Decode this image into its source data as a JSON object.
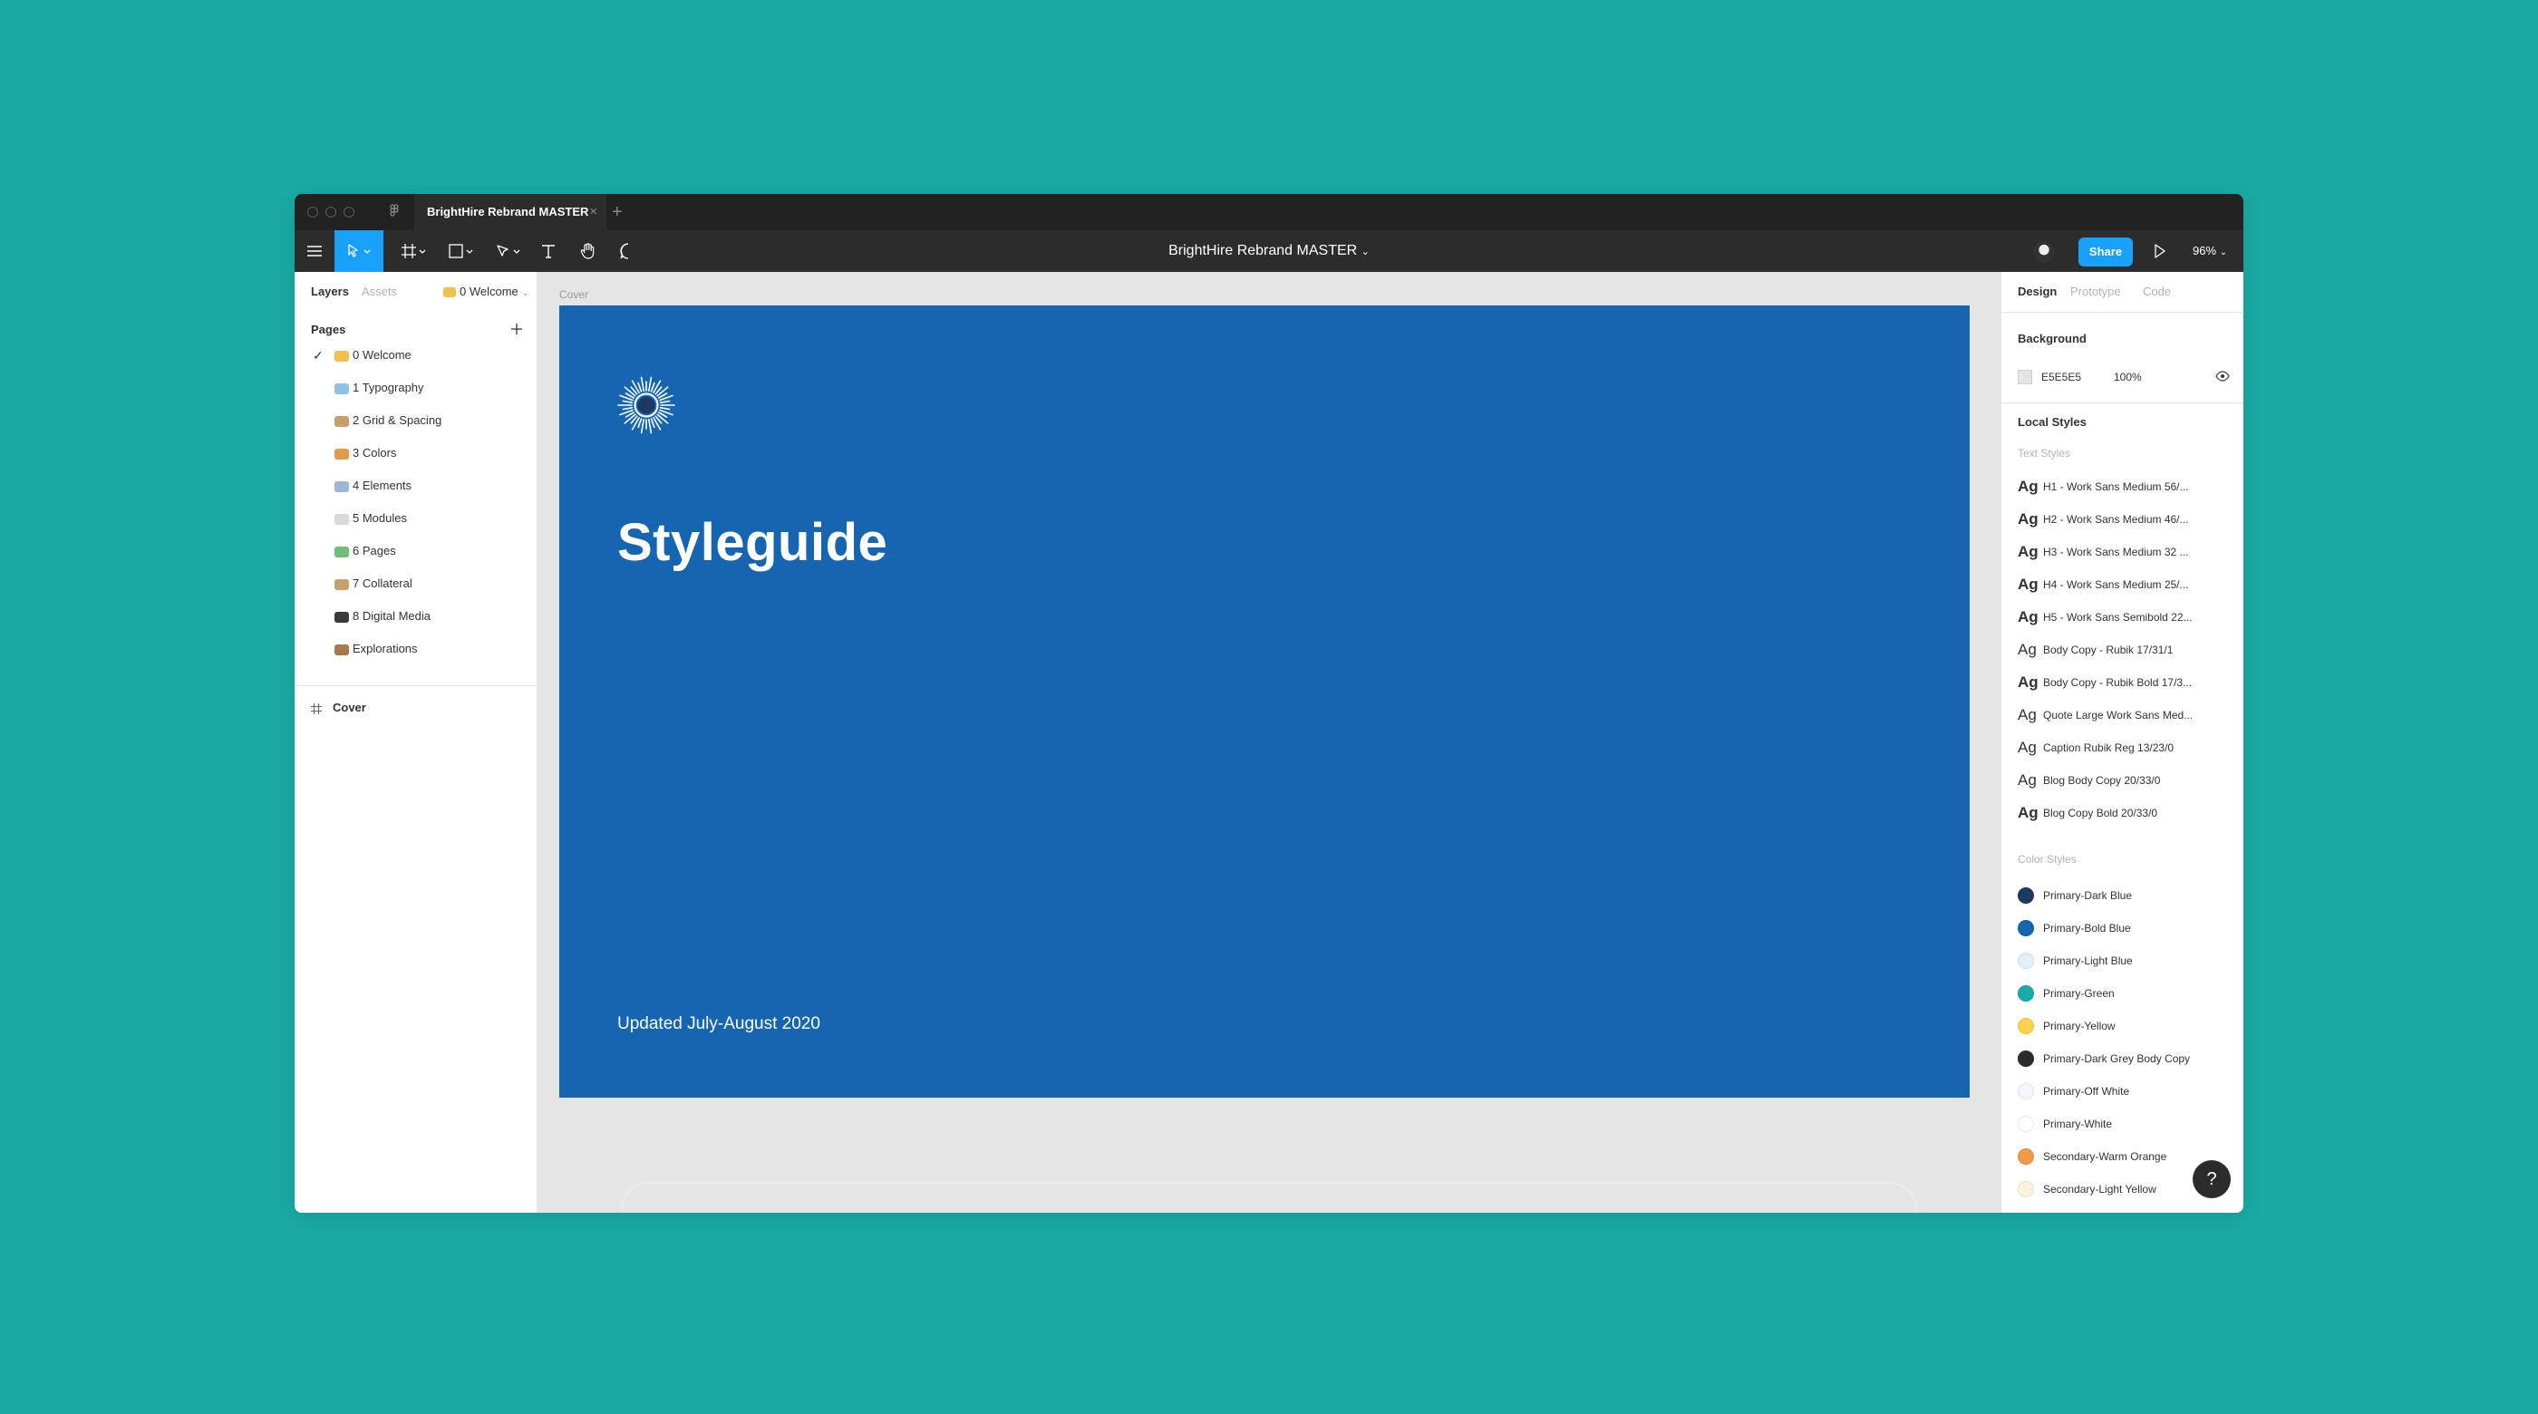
{
  "titlebar": {
    "tab_title": "BrightHire Rebrand MASTER",
    "tab_close": "×",
    "tab_add": "+"
  },
  "toolbar": {
    "doc_title": "BrightHire Rebrand MASTER",
    "share_label": "Share",
    "zoom_label": "96%"
  },
  "left_panel": {
    "tabs": [
      "Layers",
      "Assets"
    ],
    "current_page": "0 Welcome",
    "pages_title": "Pages",
    "pages": [
      {
        "label": "0 Welcome",
        "emoji_color": "#f2c04b",
        "selected": true
      },
      {
        "label": "1 Typography",
        "emoji_color": "#8ec3e6"
      },
      {
        "label": "2 Grid & Spacing",
        "emoji_color": "#c9a06b"
      },
      {
        "label": "3 Colors",
        "emoji_color": "#e39a4a"
      },
      {
        "label": "4 Elements",
        "emoji_color": "#9bb6d6"
      },
      {
        "label": "5 Modules",
        "emoji_color": "#d9d9d9"
      },
      {
        "label": "6 Pages",
        "emoji_color": "#6fbf73"
      },
      {
        "label": "7 Collateral",
        "emoji_color": "#c9a06b"
      },
      {
        "label": "8 Digital Media",
        "emoji_color": "#3a3a3a"
      },
      {
        "label": "Explorations",
        "emoji_color": "#a87a4b"
      }
    ],
    "layers": [
      {
        "label": "Cover"
      }
    ]
  },
  "canvas": {
    "frame_label": "Cover",
    "cover_title": "Styleguide",
    "cover_subtitle": "Updated July-August 2020",
    "cover_color": "#1565b0"
  },
  "right_panel": {
    "tabs": [
      "Design",
      "Prototype",
      "Code"
    ],
    "background_title": "Background",
    "background_hex": "E5E5E5",
    "background_opacity": "100%",
    "local_styles_title": "Local Styles",
    "text_styles_title": "Text Styles",
    "ag": "Ag",
    "text_styles": [
      "H1 - Work Sans Medium 56/...",
      "H2 - Work Sans Medium 46/...",
      "H3 - Work Sans Medium 32 ...",
      "H4 - Work Sans Medium 25/...",
      "H5 - Work Sans Semibold 22...",
      "Body Copy - Rubik 17/31/1",
      "Body Copy - Rubik Bold 17/3...",
      "Quote Large Work Sans Med...",
      "Caption Rubik Reg 13/23/0",
      "Blog Body Copy 20/33/0",
      "Blog Copy Bold 20/33/0"
    ],
    "color_styles_title": "Color Styles",
    "color_styles": [
      {
        "label": "Primary-Dark Blue",
        "color": "#1d3a63"
      },
      {
        "label": "Primary-Bold Blue",
        "color": "#1565b0"
      },
      {
        "label": "Primary-Light Blue",
        "color": "#dff1fb"
      },
      {
        "label": "Primary-Green",
        "color": "#1aaba4"
      },
      {
        "label": "Primary-Yellow",
        "color": "#ffd24d"
      },
      {
        "label": "Primary-Dark Grey Body Copy",
        "color": "#2b2b2b"
      },
      {
        "label": "Primary-Off White",
        "color": "#f4f6fb"
      },
      {
        "label": "Primary-White",
        "color": "#ffffff"
      },
      {
        "label": "Secondary-Warm Orange",
        "color": "#f2994a"
      },
      {
        "label": "Secondary-Light Yellow",
        "color": "#fdf3dc"
      }
    ]
  },
  "help_label": "?"
}
